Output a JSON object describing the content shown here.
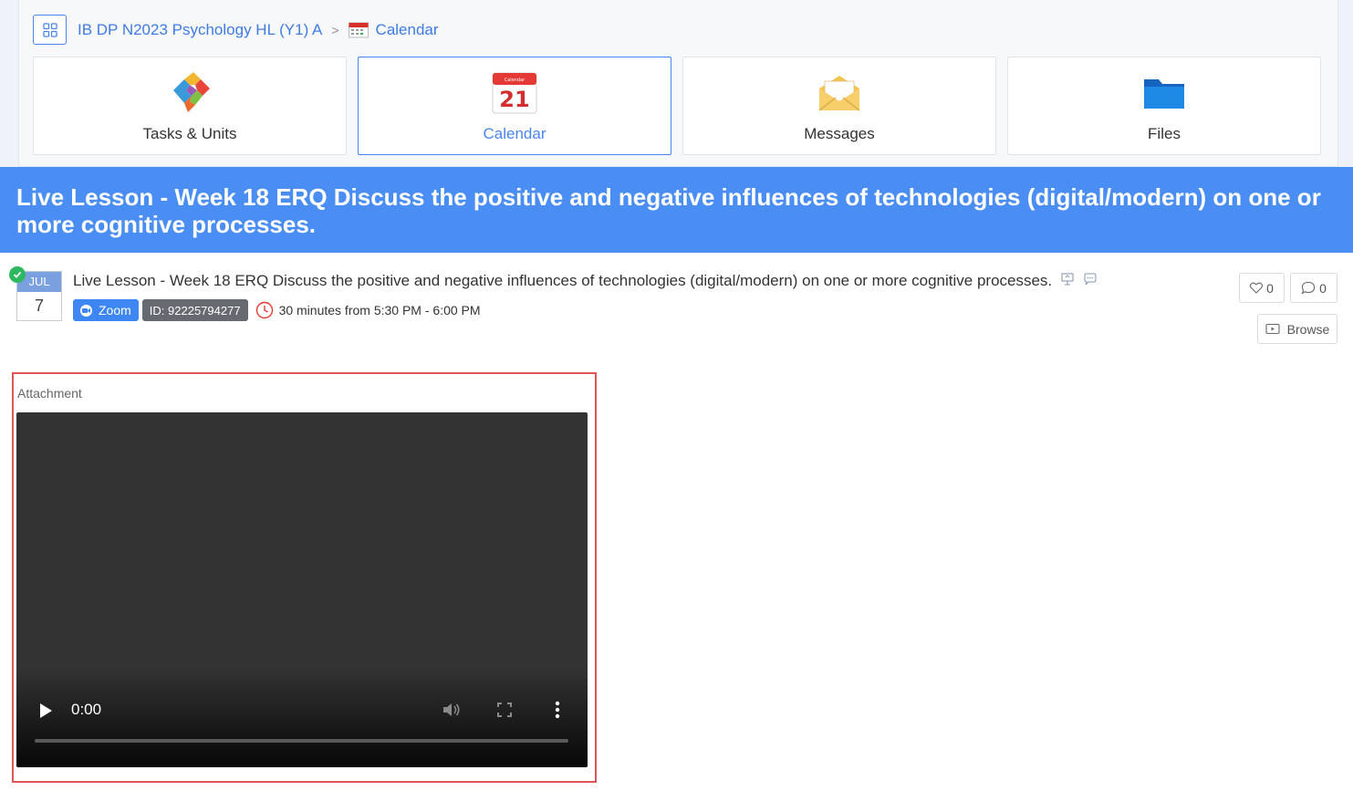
{
  "breadcrumb": {
    "course": "IB DP N2023 Psychology HL (Y1) A",
    "separator": ">",
    "current": "Calendar"
  },
  "tiles": [
    {
      "label": "Tasks & Units",
      "icon": "puzzle-icon"
    },
    {
      "label": "Calendar",
      "icon": "calendar-icon",
      "active": true
    },
    {
      "label": "Messages",
      "icon": "envelope-icon"
    },
    {
      "label": "Files",
      "icon": "folder-icon"
    }
  ],
  "banner": {
    "title": "Live Lesson - Week 18 ERQ Discuss the positive and negative influences of technologies (digital/modern) on one or more cognitive processes."
  },
  "event": {
    "month": "JUL",
    "day": "7",
    "title": "Live Lesson - Week 18 ERQ Discuss the positive and negative influences of technologies (digital/modern) on one or more cognitive processes.",
    "zoom_label": "Zoom",
    "meeting_id": "ID: 92225794277",
    "time": "30 minutes from 5:30 PM - 6:00 PM",
    "likes": "0",
    "comments": "0",
    "browse_label": "Browse"
  },
  "attachment": {
    "label": "Attachment",
    "video_time": "0:00"
  },
  "colors": {
    "accent": "#4a8ef3",
    "zoom": "#3e86f2",
    "highlight": "#e05555",
    "check": "#2fb85f"
  }
}
